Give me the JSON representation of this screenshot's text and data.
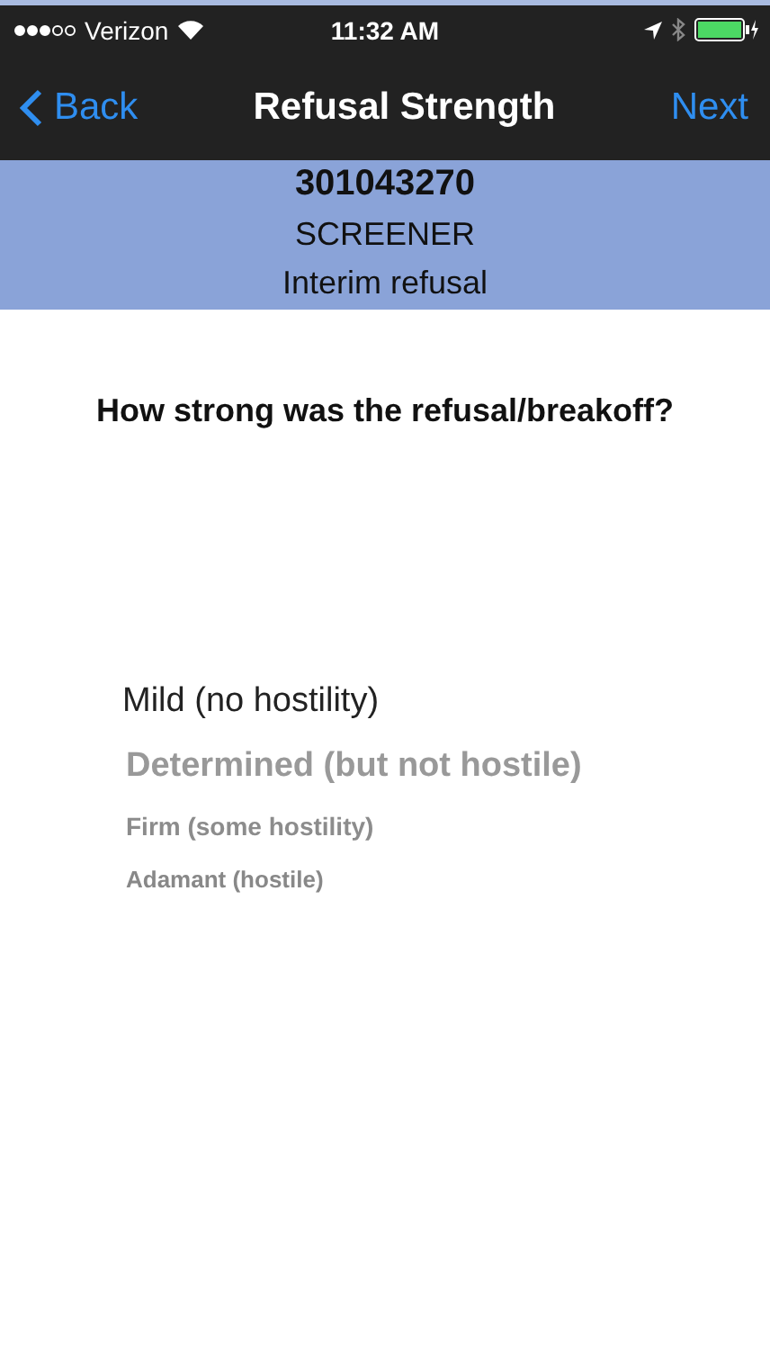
{
  "status_bar": {
    "carrier": "Verizon",
    "time": "11:32 AM"
  },
  "nav": {
    "back": "Back",
    "title": "Refusal Strength",
    "next": "Next"
  },
  "header": {
    "case_id": "301043270",
    "stage": "SCREENER",
    "status": "Interim refusal"
  },
  "question": "How strong was the refusal/breakoff?",
  "picker": [
    {
      "label": "Mild (no hostility)",
      "selected": true
    },
    {
      "label": "Determined (but not hostile)",
      "selected": false
    },
    {
      "label": "Firm (some hostility)",
      "selected": false
    },
    {
      "label": "Adamant (hostile)",
      "selected": false
    }
  ]
}
